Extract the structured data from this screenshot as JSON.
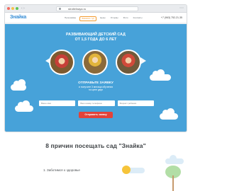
{
  "browser": {
    "url": "stroitelnaya.ru"
  },
  "site": {
    "logo": "Знайка",
    "menu": [
      "Программы",
      "Заказать тур",
      "Цены",
      "Отзывы",
      "Фото",
      "Контакты"
    ],
    "menu_active_index": 1,
    "phone": "+7 (963) 752-21-35"
  },
  "hero": {
    "title_line1": "РАЗВИВАЮЩИЙ ДЕТСКИЙ САД",
    "title_line2": "ОТ 1,5 ГОДА ДО 6 ЛЕТ",
    "cta_heading": "ОТПРАВЬТЕ ЗАЯВКУ",
    "cta_line1": "и получите 3 месяца обучения",
    "cta_line2": "по цене двух",
    "form": {
      "name_placeholder": "Ваше имя",
      "phone_placeholder": "Ваш номер телефона",
      "age_placeholder": "Возраст ребенка",
      "submit_label": "Отправить заявку"
    }
  },
  "reasons": {
    "title": "8 причин посещать сад \"Знайка\"",
    "first_item": "1. Заботимся о здоровье"
  },
  "colors": {
    "hero_bg": "#47a2d9",
    "accent_orange": "#f29a2e",
    "cta_red": "#e3423a"
  }
}
